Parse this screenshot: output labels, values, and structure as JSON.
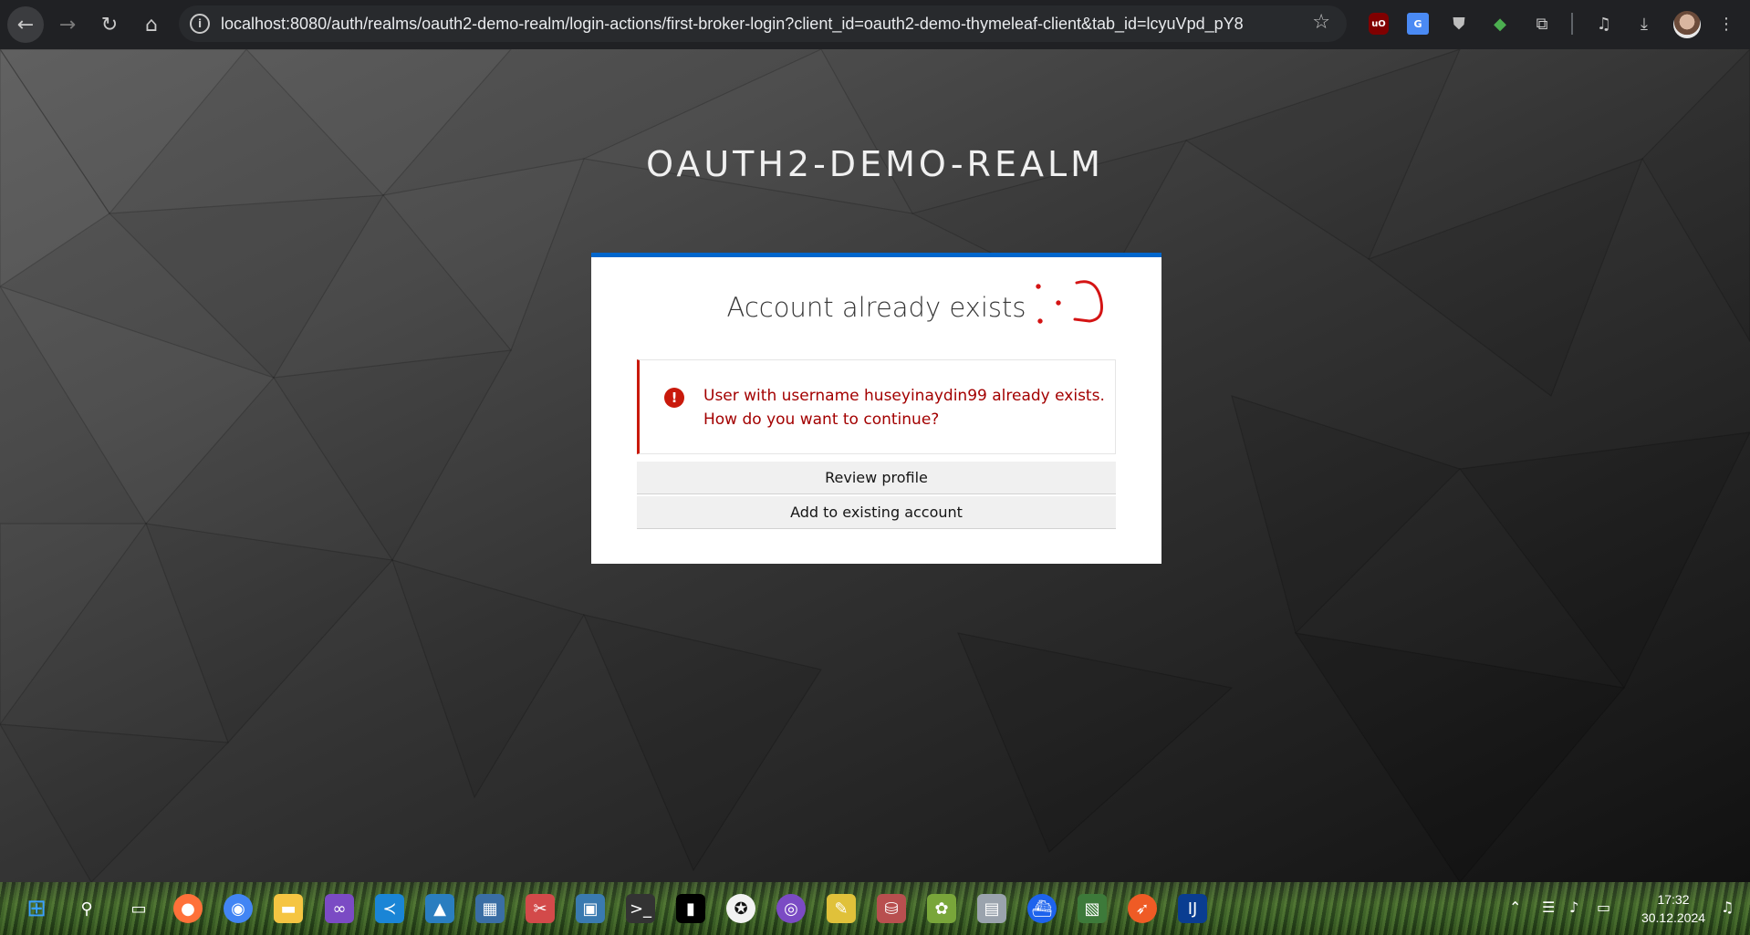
{
  "browser": {
    "url": "localhost:8080/auth/realms/oauth2-demo-realm/login-actions/first-broker-login?client_id=oauth2-demo-thymeleaf-client&tab_id=lcyuVpd_pY8",
    "extensions": {
      "ublock_label": "uO",
      "translate_label": "G"
    }
  },
  "page": {
    "realm_title": "OAUTH2-DEMO-REALM",
    "card_title": "Account already exists",
    "alert": {
      "line1": "User with username huseyinaydin99 already exists.",
      "line2": "How do you want to continue?"
    },
    "buttons": {
      "review": "Review profile",
      "add": "Add to existing account"
    }
  },
  "taskbar": {
    "time": "17:32",
    "date": "30.12.2024"
  },
  "colors": {
    "accent": "#0066cc",
    "danger": "#c9190b",
    "danger_text": "#a30000"
  }
}
